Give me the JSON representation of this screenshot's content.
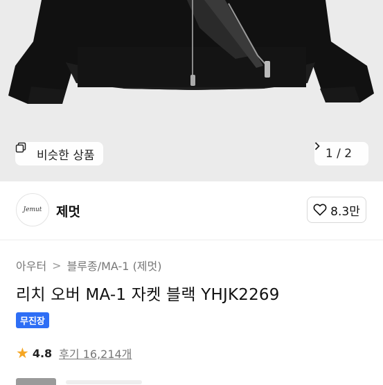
{
  "hero": {
    "similar_label": "비슷한 상품",
    "similar_icon": "copy-icon",
    "pager": "1 / 2",
    "pager_icon": "chevron-right-icon"
  },
  "brand": {
    "logo_text": "Jemut",
    "name": "제멋",
    "likes": "8.3만",
    "like_icon": "heart-icon"
  },
  "breadcrumb": {
    "category": "아우터",
    "separator": ">",
    "subcategory": "블루종/MA-1 (제멋)"
  },
  "product": {
    "title": "리치 오버 MA-1 자켓 블랙 YHJK2269",
    "badge": "무진장",
    "badge_color": "#2e6ef5",
    "rating": "4.8",
    "reviews": "후기 16,214개",
    "star_color": "#f5a623"
  }
}
